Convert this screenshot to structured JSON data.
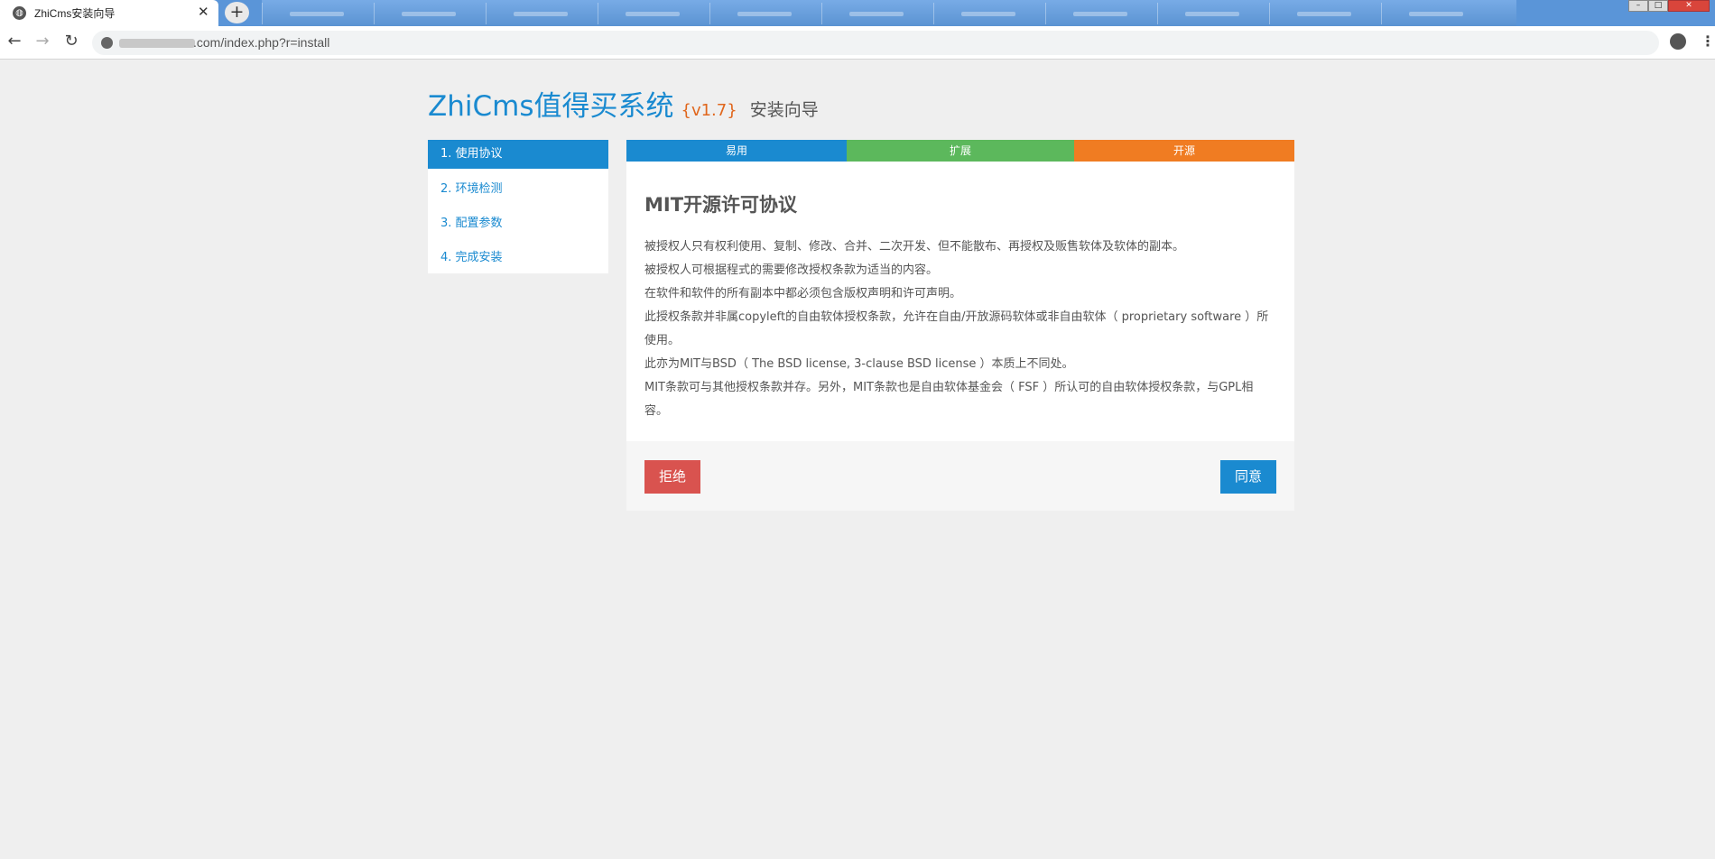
{
  "browser": {
    "tab_title": "ZhiCms安装向导",
    "tab_close": "✕",
    "newtab": "+",
    "url": ".com/index.php?r=install",
    "nav_back": "←",
    "nav_forward": "→",
    "nav_reload": "↻",
    "menu": "⋮"
  },
  "header": {
    "brand": "ZhiCms值得买系统",
    "version": "{v1.7}",
    "subtitle": "安装向导"
  },
  "sidebar": {
    "items": [
      {
        "label": "1. 使用协议"
      },
      {
        "label": "2. 环境检测"
      },
      {
        "label": "3. 配置参数"
      },
      {
        "label": "4. 完成安装"
      }
    ]
  },
  "features": {
    "items": [
      {
        "label": "易用",
        "color": "#1a8ad0"
      },
      {
        "label": "扩展",
        "color": "#5cb85c"
      },
      {
        "label": "开源",
        "color": "#f07c22"
      }
    ]
  },
  "license": {
    "title": "MIT开源许可协议",
    "paragraphs": [
      "被授权人只有权利使用、复制、修改、合并、二次开发、但不能散布、再授权及贩售软体及软体的副本。",
      "被授权人可根据程式的需要修改授权条款为适当的内容。",
      "在软件和软件的所有副本中都必须包含版权声明和许可声明。",
      "此授权条款并非属copyleft的自由软体授权条款，允许在自由/开放源码软体或非自由软体（ proprietary software ）所使用。",
      "此亦为MIT与BSD（ The BSD license, 3-clause BSD license ）本质上不同处。",
      "MIT条款可与其他授权条款并存。另外，MIT条款也是自由软体基金会（ FSF ）所认可的自由软体授权条款，与GPL相容。"
    ]
  },
  "actions": {
    "reject_label": "拒绝",
    "agree_label": "同意"
  },
  "colors": {
    "accent": "#1a8ad0",
    "danger": "#d9534f",
    "version": "#e0661c"
  }
}
